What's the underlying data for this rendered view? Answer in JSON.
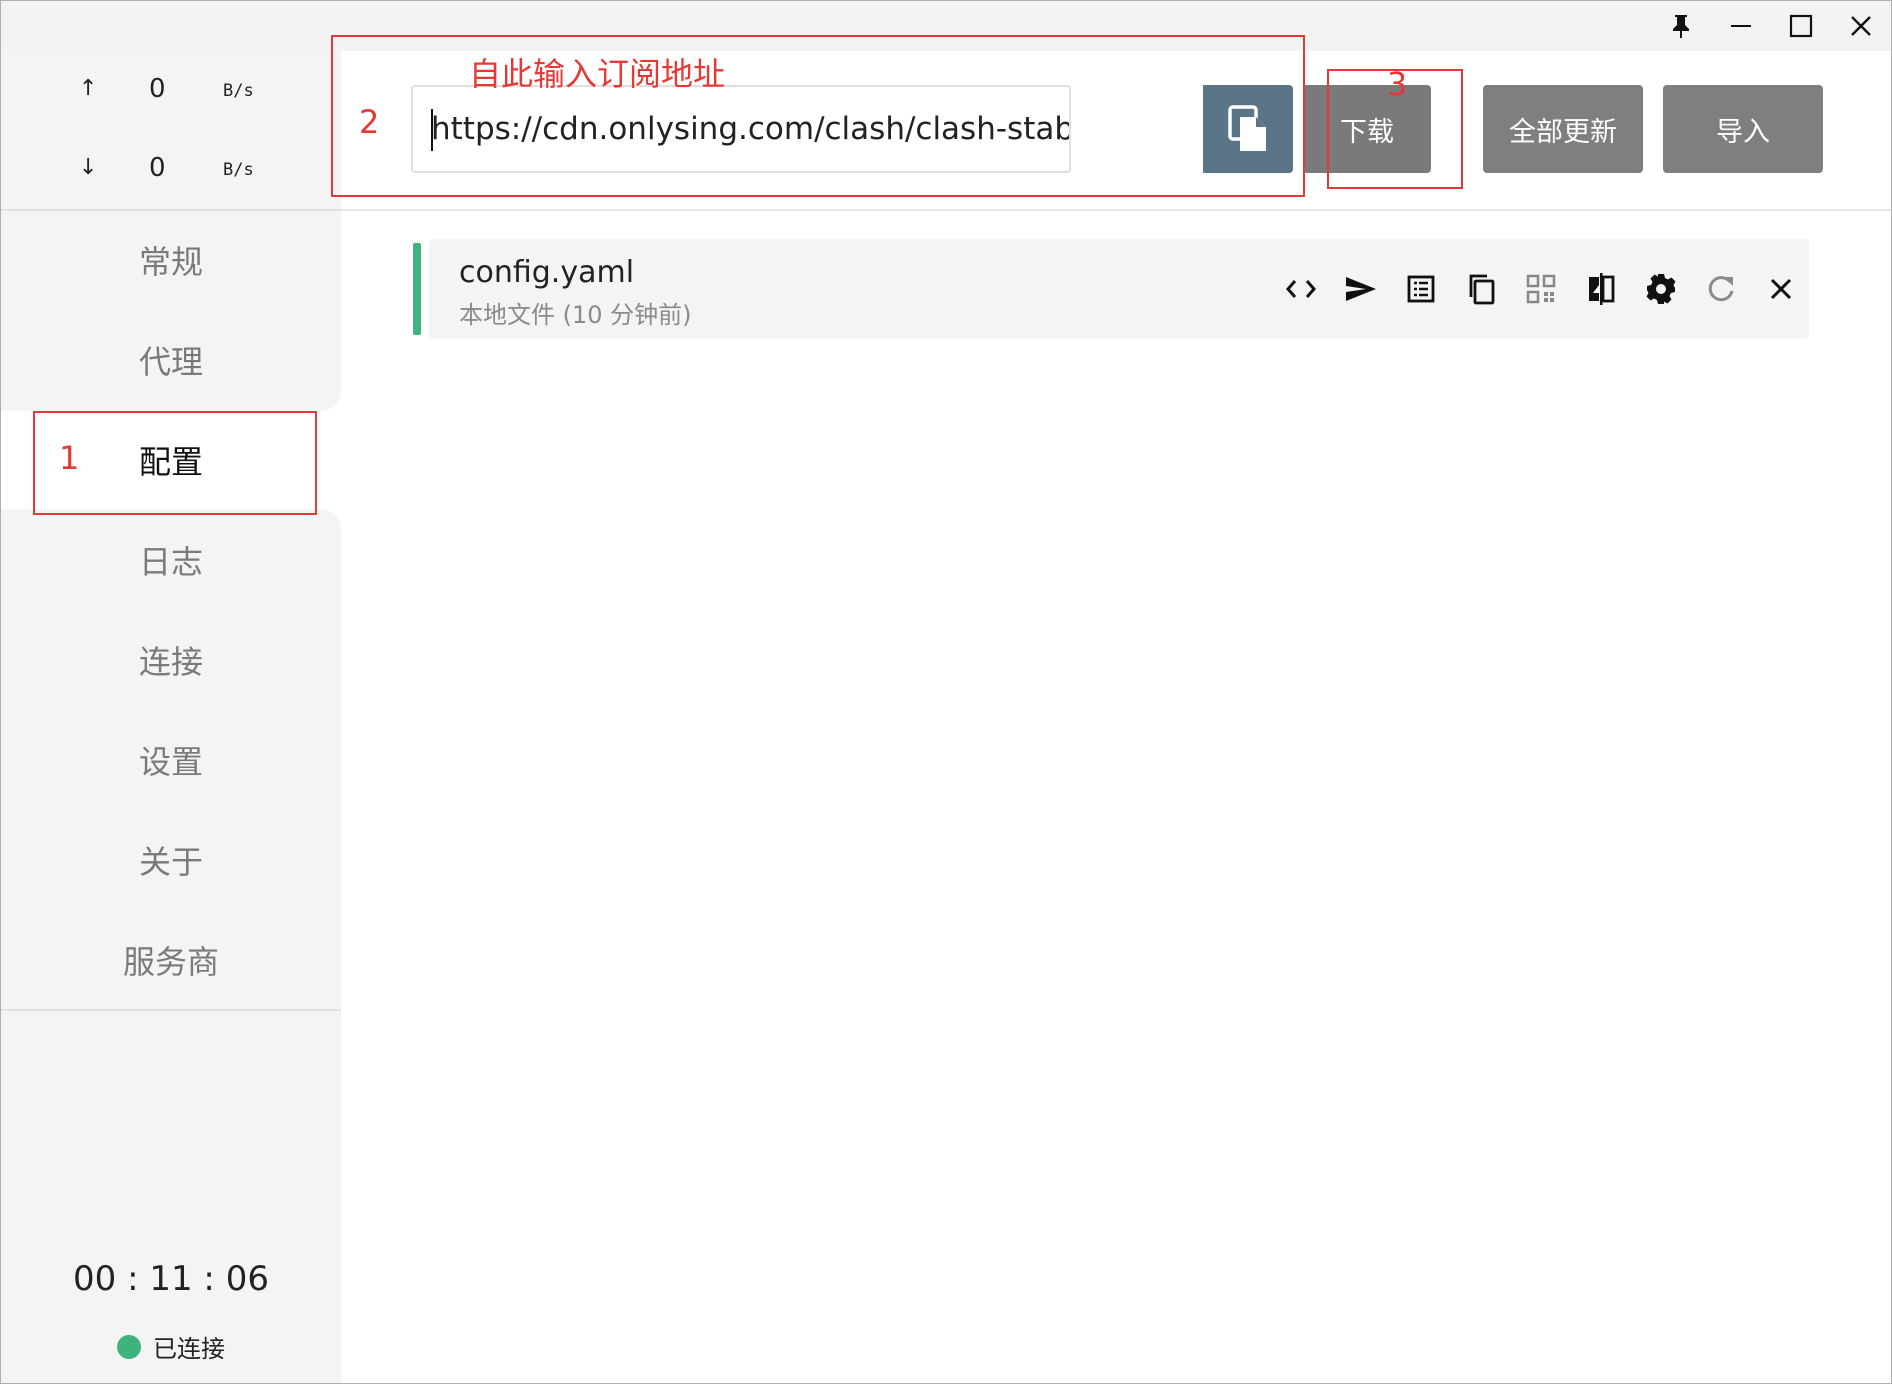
{
  "traffic": {
    "up_arrow": "↑",
    "up_value": "0",
    "up_unit": "B/s",
    "down_arrow": "↓",
    "down_value": "0",
    "down_unit": "B/s"
  },
  "nav": {
    "items": [
      {
        "label": "常规"
      },
      {
        "label": "代理"
      },
      {
        "label": "配置"
      },
      {
        "label": "日志"
      },
      {
        "label": "连接"
      },
      {
        "label": "设置"
      },
      {
        "label": "关于"
      },
      {
        "label": "服务商"
      }
    ],
    "active_index": 2
  },
  "session": {
    "timer": "00 : 11 : 06",
    "status_label": "已连接",
    "status_color": "#3eb47c"
  },
  "toolbar": {
    "url_value": "https://cdn.onlysing.com/clash/clash-stables.yam",
    "paste_icon": "paste-icon",
    "download_label": "下载",
    "update_all_label": "全部更新",
    "import_label": "导入"
  },
  "profile": {
    "name": "config.yaml",
    "subtitle": "本地文件 (10 分钟前)",
    "accent_color": "#3eb47c",
    "actions": [
      "code-icon",
      "send-icon",
      "list-icon",
      "copy-icon",
      "qr-code-icon",
      "compare-icon",
      "gear-icon",
      "refresh-icon",
      "close-icon"
    ]
  },
  "annotations": {
    "label_1": "1",
    "label_2": "2",
    "label_3": "3",
    "hint": "自此输入订阅地址",
    "color": "#e53935"
  },
  "window_controls": [
    "pin-icon",
    "minimize-icon",
    "maximize-icon",
    "close-window-icon"
  ]
}
